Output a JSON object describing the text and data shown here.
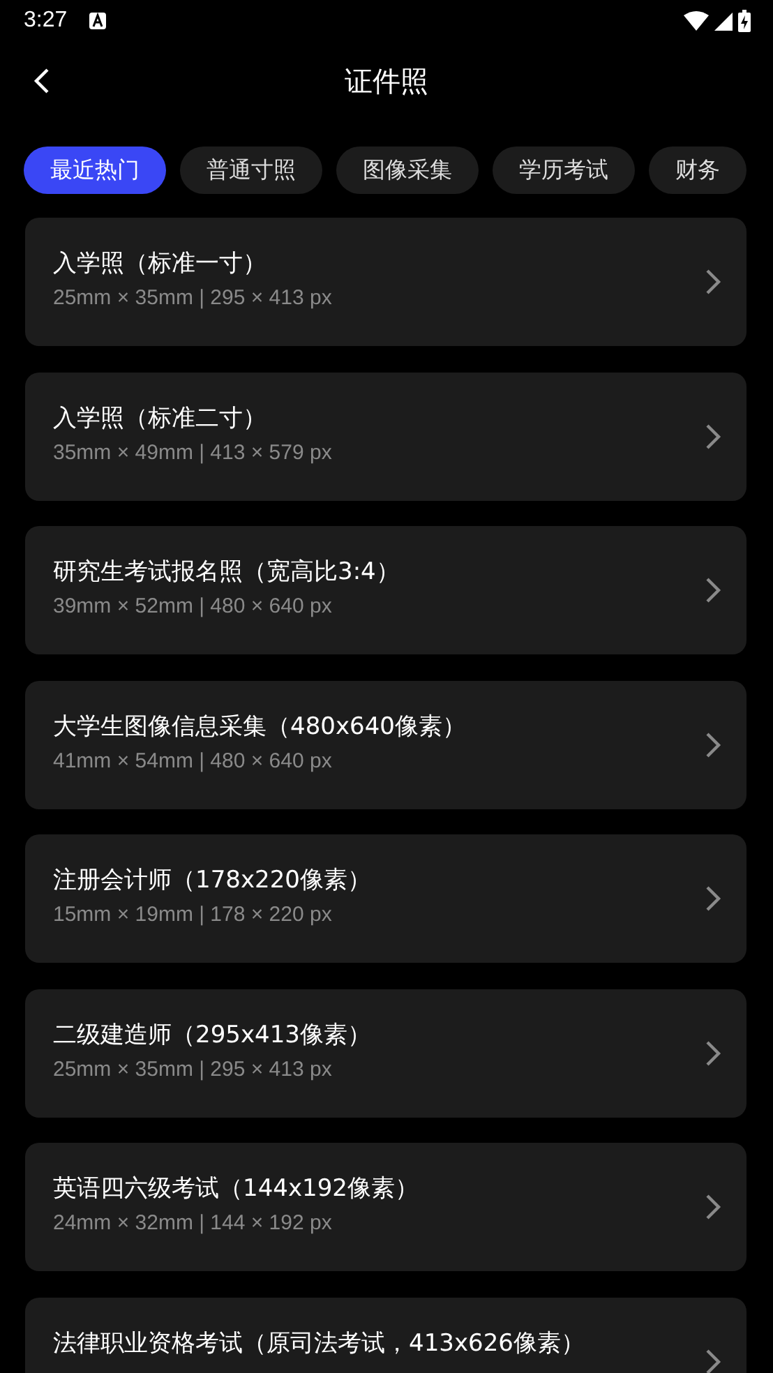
{
  "status_bar": {
    "time": "3:27"
  },
  "header": {
    "title": "证件照"
  },
  "tabs": [
    {
      "label": "最近热门",
      "selected": true
    },
    {
      "label": "普通寸照",
      "selected": false
    },
    {
      "label": "图像采集",
      "selected": false
    },
    {
      "label": "学历考试",
      "selected": false
    },
    {
      "label": "财务",
      "selected": false
    }
  ],
  "items": [
    {
      "title": "入学照（标准一寸）",
      "size": "25mm × 35mm | 295 × 413 px"
    },
    {
      "title": "入学照（标准二寸）",
      "size": "35mm × 49mm | 413 × 579 px"
    },
    {
      "title": "研究生考试报名照（宽高比3:4）",
      "size": "39mm × 52mm | 480 × 640 px"
    },
    {
      "title": "大学生图像信息采集（480x640像素）",
      "size": "41mm × 54mm | 480 × 640 px"
    },
    {
      "title": "注册会计师（178x220像素）",
      "size": "15mm × 19mm | 178 × 220 px"
    },
    {
      "title": "二级建造师（295x413像素）",
      "size": "25mm × 35mm | 295 × 413 px"
    },
    {
      "title": "英语四六级考试（144x192像素）",
      "size": "24mm × 32mm | 144 × 192 px"
    },
    {
      "title": "法律职业资格考试（原司法考试，413x626像素）"
    }
  ]
}
